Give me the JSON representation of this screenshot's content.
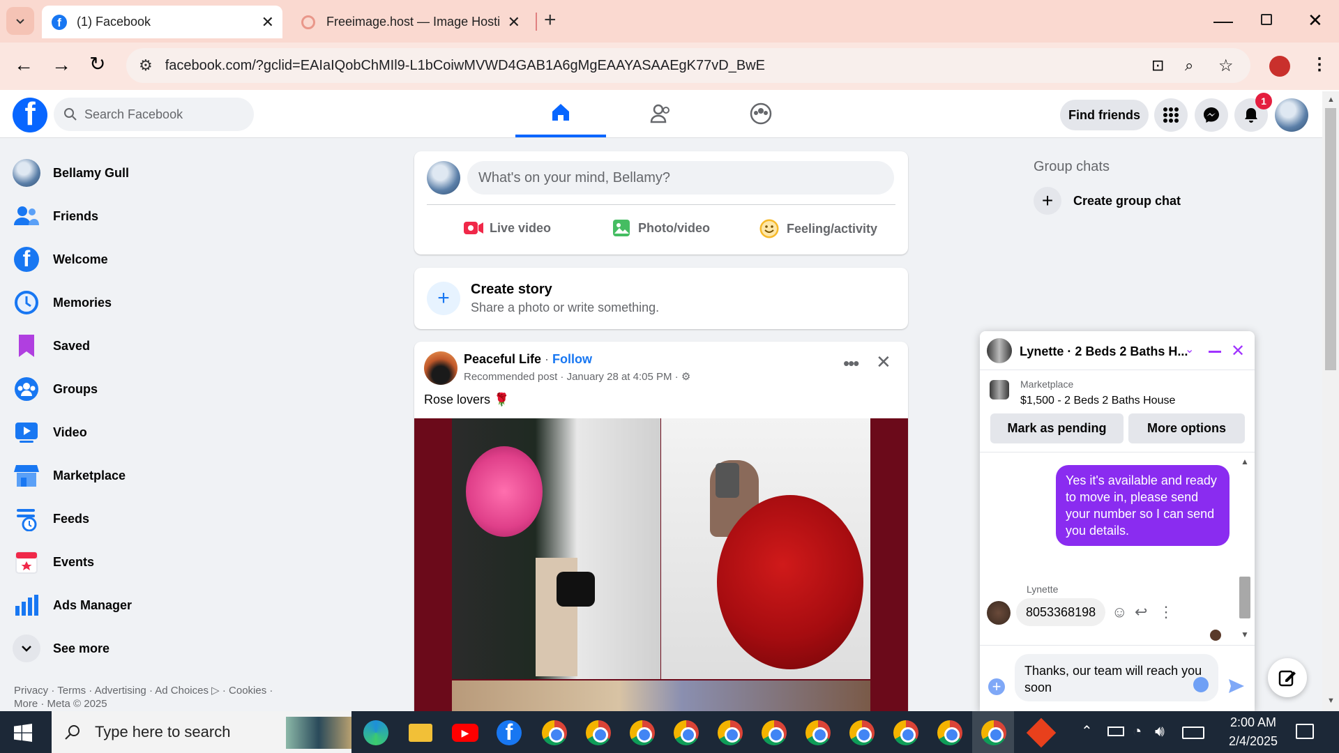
{
  "browser": {
    "tabs": [
      {
        "title": "(1) Facebook"
      },
      {
        "title": "Freeimage.host — Image Hosti"
      }
    ],
    "url": "facebook.com/?gclid=EAIaIQobChMIl9-L1bCoiwMVWD4GAB1A6gMgEAAYASAAEgK77vD_BwE"
  },
  "fb": {
    "search_placeholder": "Search Facebook",
    "find_friends": "Find friends",
    "notif_count": "1"
  },
  "sidebar": {
    "items": [
      {
        "label": "Bellamy Gull",
        "icon": "avatar"
      },
      {
        "label": "Friends",
        "icon": "friends-icon"
      },
      {
        "label": "Welcome",
        "icon": "facebook-icon"
      },
      {
        "label": "Memories",
        "icon": "clock-icon"
      },
      {
        "label": "Saved",
        "icon": "bookmark-icon"
      },
      {
        "label": "Groups",
        "icon": "groups-icon"
      },
      {
        "label": "Video",
        "icon": "video-icon"
      },
      {
        "label": "Marketplace",
        "icon": "shop-icon"
      },
      {
        "label": "Feeds",
        "icon": "feeds-icon"
      },
      {
        "label": "Events",
        "icon": "calendar-icon"
      },
      {
        "label": "Ads Manager",
        "icon": "chart-icon"
      },
      {
        "label": "See more",
        "icon": "chevron-down-icon"
      }
    ],
    "footer_line1": "Privacy · Terms · Advertising · Ad Choices ▷ · Cookies ·",
    "footer_line2": "More · Meta © 2025"
  },
  "composer": {
    "placeholder": "What's on your mind, Bellamy?",
    "live": "Live video",
    "photo": "Photo/video",
    "feeling": "Feeling/activity"
  },
  "story": {
    "title": "Create story",
    "subtitle": "Share a photo or write something."
  },
  "post": {
    "author": "Peaceful Life",
    "follow": "Follow",
    "meta": "Recommended post · January 28 at 4:05 PM ·",
    "text": "Rose lovers 🌹"
  },
  "right": {
    "group_chats": "Group chats",
    "create_group": "Create group chat"
  },
  "chat": {
    "title": "Lynette · 2 Beds 2 Baths H...",
    "marketplace": "Marketplace",
    "listing": "$1,500 - 2 Beds 2 Baths House",
    "mark_pending": "Mark as pending",
    "more_options": "More options",
    "sent": "Yes it's available and ready to move in, please send your number so I can send you details.",
    "sender": "Lynette",
    "received": "8053368198",
    "draft": "Thanks, our team will reach you soon"
  },
  "taskbar": {
    "search_placeholder": "Type here to search",
    "time": "2:00 AM",
    "date": "2/4/2025"
  },
  "colors": {
    "fb_blue": "#1877f2",
    "messenger_purple": "#7b2ff7",
    "tab_pink": "#fad9d0"
  }
}
